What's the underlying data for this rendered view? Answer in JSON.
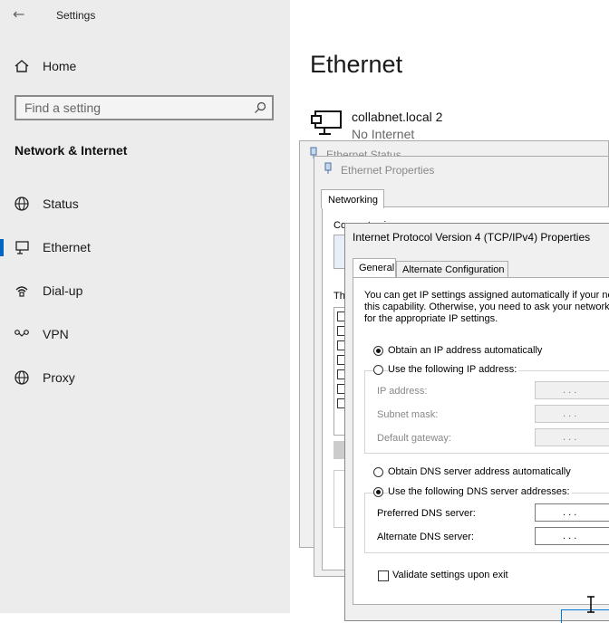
{
  "app": {
    "title": "Settings"
  },
  "nav": {
    "home": "Home",
    "search_placeholder": "Find a setting",
    "section": "Network & Internet",
    "items": [
      {
        "label": "Status",
        "icon": "globe-icon"
      },
      {
        "label": "Ethernet",
        "icon": "monitor-icon",
        "active": true
      },
      {
        "label": "Dial-up",
        "icon": "dialup-icon"
      },
      {
        "label": "VPN",
        "icon": "vpn-icon"
      },
      {
        "label": "Proxy",
        "icon": "globe-icon"
      }
    ]
  },
  "main": {
    "title": "Ethernet",
    "network": {
      "name": "collabnet.local 2",
      "status": "No Internet"
    }
  },
  "status_window": {
    "title": "Ethernet Status"
  },
  "properties_window": {
    "title": "Ethernet Properties",
    "tab": "Networking",
    "connect_using": "Connect using:",
    "these_items": "Th"
  },
  "ipv4": {
    "title": "Internet Protocol Version 4 (TCP/IPv4) Properties",
    "tabs": [
      "General",
      "Alternate Configuration"
    ],
    "description": [
      "You can get IP settings assigned automatically if your ne",
      "this capability. Otherwise, you need to ask your network",
      "for the appropriate IP settings."
    ],
    "obtain_ip_auto": "Obtain an IP address automatically",
    "use_following_ip": "Use the following IP address:",
    "ip_address": "IP address:",
    "subnet_mask": "Subnet mask:",
    "default_gateway": "Default gateway:",
    "obtain_dns_auto": "Obtain DNS server address automatically",
    "use_following_dns": "Use the following DNS server addresses:",
    "preferred_dns": "Preferred DNS server:",
    "alternate_dns": "Alternate DNS server:",
    "ip_placeholder": ".     .     .",
    "validate": "Validate settings upon exit"
  }
}
